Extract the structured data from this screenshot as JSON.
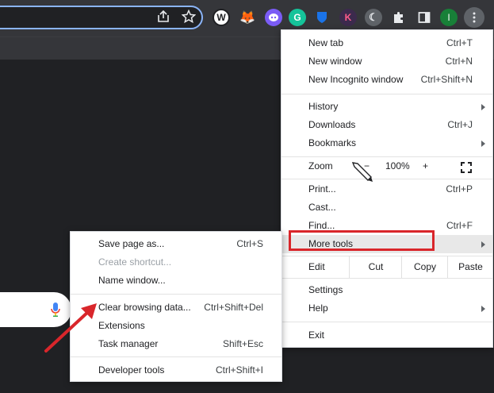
{
  "colors": {
    "accent": "#8ab4f8",
    "highlight": "#d9262b",
    "toolbar": "#35363a",
    "menu_bg": "#ffffff"
  },
  "toolbar": {
    "share_icon": "share-icon",
    "bookmark_icon": "star-icon",
    "extensions": [
      {
        "name": "w-extension",
        "glyph": "W",
        "color": "#202124"
      },
      {
        "name": "metamask-fox",
        "glyph": "🦊",
        "color": "#35363a"
      },
      {
        "name": "ghost-extension",
        "glyph": "●",
        "color": "#7b5cf5"
      },
      {
        "name": "grammarly",
        "glyph": "G",
        "color": "#15c39a"
      },
      {
        "name": "bitwarden",
        "glyph": "⬢",
        "color": "#1a73e8"
      },
      {
        "name": "k-extension",
        "glyph": "K",
        "color": "#3c2a4d"
      },
      {
        "name": "dark-mode-extension",
        "glyph": "☾",
        "color": "#5f6368"
      }
    ],
    "puzzle_icon": "puzzle-icon",
    "sidepanel_icon": "sidepanel-icon",
    "profile_initial": "I",
    "kebab_icon": "kebab-menu-icon"
  },
  "menu": {
    "new_tab": {
      "label": "New tab",
      "shortcut": "Ctrl+T"
    },
    "new_window": {
      "label": "New window",
      "shortcut": "Ctrl+N"
    },
    "new_incognito": {
      "label": "New Incognito window",
      "shortcut": "Ctrl+Shift+N"
    },
    "history": {
      "label": "History"
    },
    "downloads": {
      "label": "Downloads",
      "shortcut": "Ctrl+J"
    },
    "bookmarks": {
      "label": "Bookmarks"
    },
    "zoom": {
      "label": "Zoom",
      "minus": "−",
      "value": "100%",
      "plus": "+"
    },
    "print": {
      "label": "Print...",
      "shortcut": "Ctrl+P"
    },
    "cast": {
      "label": "Cast..."
    },
    "find": {
      "label": "Find...",
      "shortcut": "Ctrl+F"
    },
    "more_tools": {
      "label": "More tools"
    },
    "edit": {
      "label": "Edit",
      "cut": "Cut",
      "copy": "Copy",
      "paste": "Paste"
    },
    "settings": {
      "label": "Settings"
    },
    "help": {
      "label": "Help"
    },
    "exit": {
      "label": "Exit"
    }
  },
  "submenu": {
    "save_page": {
      "label": "Save page as...",
      "shortcut": "Ctrl+S"
    },
    "create_shortcut": {
      "label": "Create shortcut..."
    },
    "name_window": {
      "label": "Name window..."
    },
    "clear_data": {
      "label": "Clear browsing data...",
      "shortcut": "Ctrl+Shift+Del"
    },
    "extensions": {
      "label": "Extensions"
    },
    "task_manager": {
      "label": "Task manager",
      "shortcut": "Shift+Esc"
    },
    "developer_tools": {
      "label": "Developer tools",
      "shortcut": "Ctrl+Shift+I"
    }
  }
}
